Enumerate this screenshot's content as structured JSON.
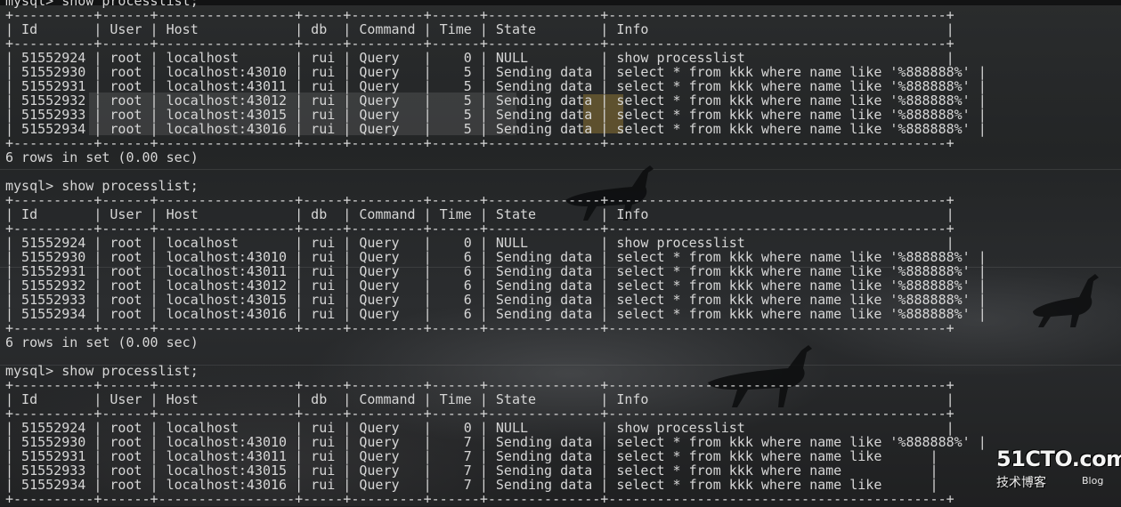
{
  "terminal": {
    "lines": [
      "mysql> show processlist;",
      "+----------+------+-----------------+-----+---------+------+--------------+------------------------------------------+",
      "| Id       | User | Host            | db  | Command | Time | State        | Info                                     |",
      "+----------+------+-----------------+-----+---------+------+--------------+------------------------------------------+",
      "| 51552924 | root | localhost       | rui | Query   |    0 | NULL         | show processlist                         |",
      "| 51552930 | root | localhost:43010 | rui | Query   |    5 | Sending data | select * from kkk where name like '%888888%' |",
      "| 51552931 | root | localhost:43011 | rui | Query   |    5 | Sending data | select * from kkk where name like '%888888%' |",
      "| 51552932 | root | localhost:43012 | rui | Query   |    5 | Sending data | select * from kkk where name like '%888888%' |",
      "| 51552933 | root | localhost:43015 | rui | Query   |    5 | Sending data | select * from kkk where name like '%888888%' |",
      "| 51552934 | root | localhost:43016 | rui | Query   |    5 | Sending data | select * from kkk where name like '%888888%' |",
      "+----------+------+-----------------+-----+---------+------+--------------+------------------------------------------+",
      "6 rows in set (0.00 sec)",
      "",
      "mysql> show processlist;",
      "+----------+------+-----------------+-----+---------+------+--------------+------------------------------------------+",
      "| Id       | User | Host            | db  | Command | Time | State        | Info                                     |",
      "+----------+------+-----------------+-----+---------+------+--------------+------------------------------------------+",
      "| 51552924 | root | localhost       | rui | Query   |    0 | NULL         | show processlist                         |",
      "| 51552930 | root | localhost:43010 | rui | Query   |    6 | Sending data | select * from kkk where name like '%888888%' |",
      "| 51552931 | root | localhost:43011 | rui | Query   |    6 | Sending data | select * from kkk where name like '%888888%' |",
      "| 51552932 | root | localhost:43012 | rui | Query   |    6 | Sending data | select * from kkk where name like '%888888%' |",
      "| 51552933 | root | localhost:43015 | rui | Query   |    6 | Sending data | select * from kkk where name like '%888888%' |",
      "| 51552934 | root | localhost:43016 | rui | Query   |    6 | Sending data | select * from kkk where name like '%888888%' |",
      "+----------+------+-----------------+-----+---------+------+--------------+------------------------------------------+",
      "6 rows in set (0.00 sec)",
      "",
      "mysql> show processlist;",
      "+----------+------+-----------------+-----+---------+------+--------------+------------------------------------------+",
      "| Id       | User | Host            | db  | Command | Time | State        | Info                                     |",
      "+----------+------+-----------------+-----+---------+------+--------------+------------------------------------------+",
      "| 51552924 | root | localhost       | rui | Query   |    0 | NULL         | show processlist                         |",
      "| 51552930 | root | localhost:43010 | rui | Query   |    7 | Sending data | select * from kkk where name like '%888888%' |",
      "| 51552931 | root | localhost:43011 | rui | Query   |    7 | Sending data | select * from kkk where name like      |",
      "| 51552933 | root | localhost:43015 | rui | Query   |    7 | Sending data | select * from kkk where name           |",
      "| 51552934 | root | localhost:43016 | rui | Query   |    7 | Sending data | select * from kkk where name like      |",
      "+----------+------+-----------------+-----+---------+------+--------------+------------------------------------------+"
    ]
  },
  "watermark": {
    "brand": "51CTO.com",
    "subtitle": "技术博客",
    "blog": "Blog"
  },
  "colors": {
    "terminal_text": "#d6d6d6",
    "background": "#232526"
  }
}
